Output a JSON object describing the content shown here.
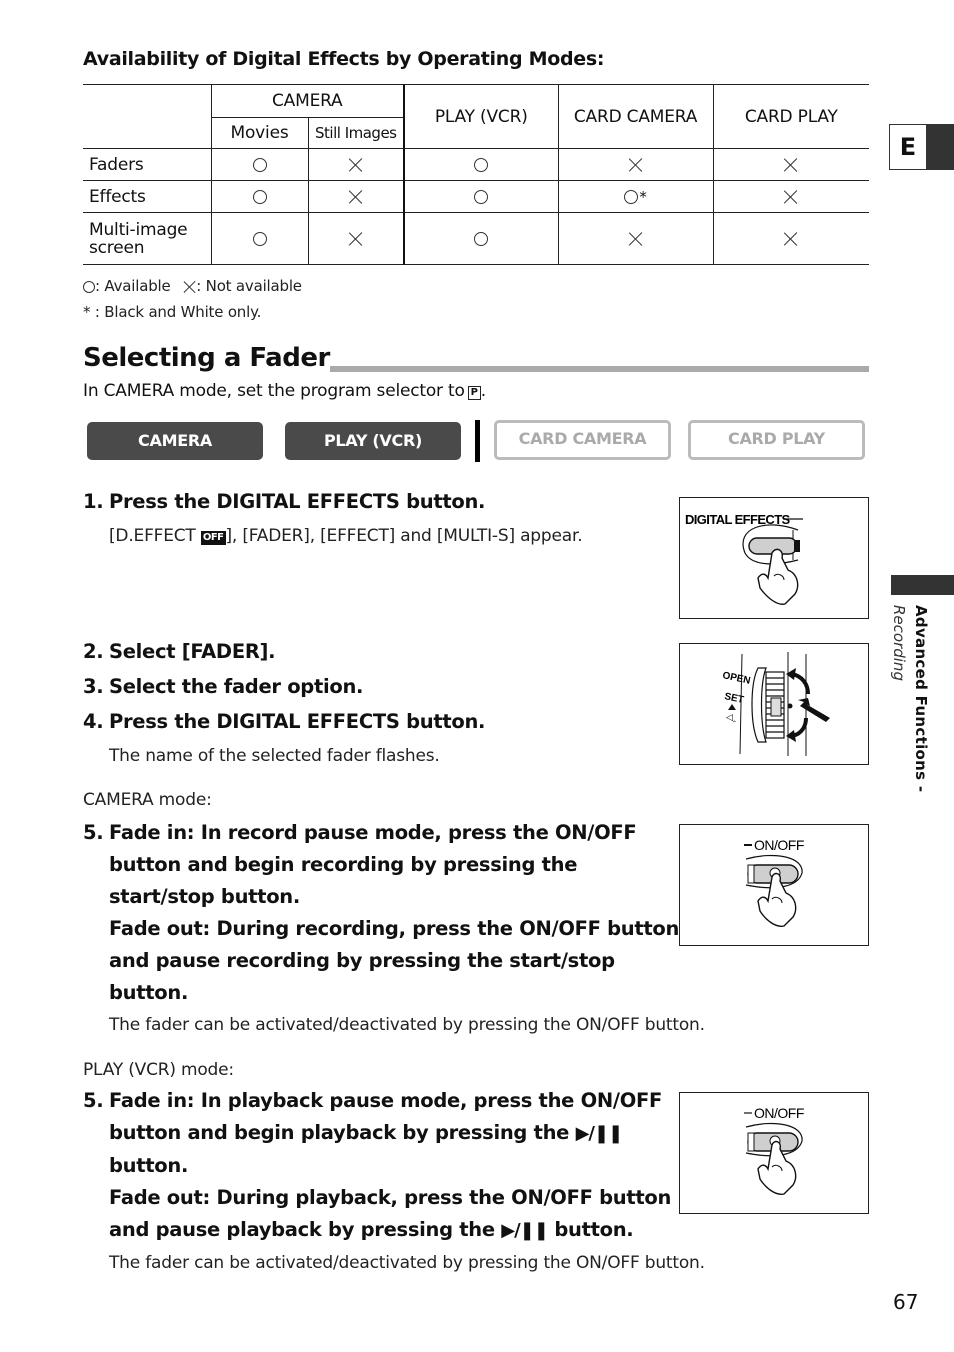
{
  "table": {
    "title": "Availability of Digital Effects by Operating Modes:",
    "group_header": "CAMERA",
    "sub_headers": [
      "Movies",
      "Still Images"
    ],
    "headers": [
      "PLAY (VCR)",
      "CARD CAMERA",
      "CARD PLAY"
    ],
    "rows": [
      {
        "label": "Faders",
        "values": [
          "available",
          "not-available",
          "available",
          "not-available",
          "not-available"
        ],
        "notes": [
          "",
          "",
          "",
          "",
          ""
        ]
      },
      {
        "label": "Effects",
        "values": [
          "available",
          "not-available",
          "available",
          "available",
          "not-available"
        ],
        "notes": [
          "",
          "",
          "",
          "*",
          ""
        ]
      },
      {
        "label_line1": "Multi-image",
        "label_line2": "screen",
        "values": [
          "available",
          "not-available",
          "available",
          "not-available",
          "not-available"
        ],
        "notes": [
          "",
          "",
          "",
          "",
          ""
        ]
      }
    ],
    "legend_available": ": Available",
    "legend_not_available": ": Not available",
    "footnote": "* : Black and White only."
  },
  "section": {
    "title": "Selecting a Fader",
    "intro": "In CAMERA mode, set the program selector to",
    "intro_icon": "P",
    "intro_end": "."
  },
  "modes": [
    {
      "label": "CAMERA",
      "active": true
    },
    {
      "label": "PLAY (VCR)",
      "active": true
    },
    {
      "label": "CARD CAMERA",
      "active": false
    },
    {
      "label": "CARD PLAY",
      "active": false
    }
  ],
  "steps": {
    "s1_num": "1.",
    "s1_text": "Press the DIGITAL EFFECTS button.",
    "s1_sub_a": "[D.EFFECT ",
    "s1_sub_icon": "OFF",
    "s1_sub_b": "], [FADER], [EFFECT] and [MULTI-S] appear.",
    "s2_num": "2.",
    "s2_text": "Select [FADER].",
    "s3_num": "3.",
    "s3_text": "Select the fader option.",
    "s4_num": "4.",
    "s4_text": "Press the DIGITAL EFFECTS button.",
    "s4_sub": "The name of the selected fader flashes.",
    "camera_mode_label": "CAMERA mode:",
    "s5a_num": "5.",
    "s5a_lines": [
      "Fade in: In record pause mode, press the ON/OFF",
      "button and begin recording by pressing the",
      "start/stop button.",
      "Fade out: During recording, press the ON/OFF button",
      "and pause recording by pressing the start/stop",
      "button."
    ],
    "s5a_sub": "The fader can be activated/deactivated by pressing the ON/OFF button.",
    "play_mode_label": "PLAY (VCR) mode:",
    "s5b_num": "5.",
    "s5b_line1": "Fade in: In playback pause mode, press the ON/OFF",
    "s5b_line2_a": "button and begin playback by pressing the ",
    "s5b_playpause": "▶/❚❚",
    "s5b_line3": "button.",
    "s5b_line4": "Fade out: During playback, press the ON/OFF button",
    "s5b_line5_a": "and pause playback by pressing the ",
    "s5b_line5_b": " button.",
    "s5b_sub": "The fader can be activated/deactivated by pressing the ON/OFF button."
  },
  "illustrations": {
    "digital_effects_label": "DIGITAL EFFECTS",
    "dial_labels": [
      "OPEN",
      "SET"
    ],
    "onoff_label": "ON/OFF"
  },
  "side": {
    "lang_tab": "E",
    "chapter": "Advanced Functions -",
    "subchapter": "Recording"
  },
  "page_number": "67"
}
